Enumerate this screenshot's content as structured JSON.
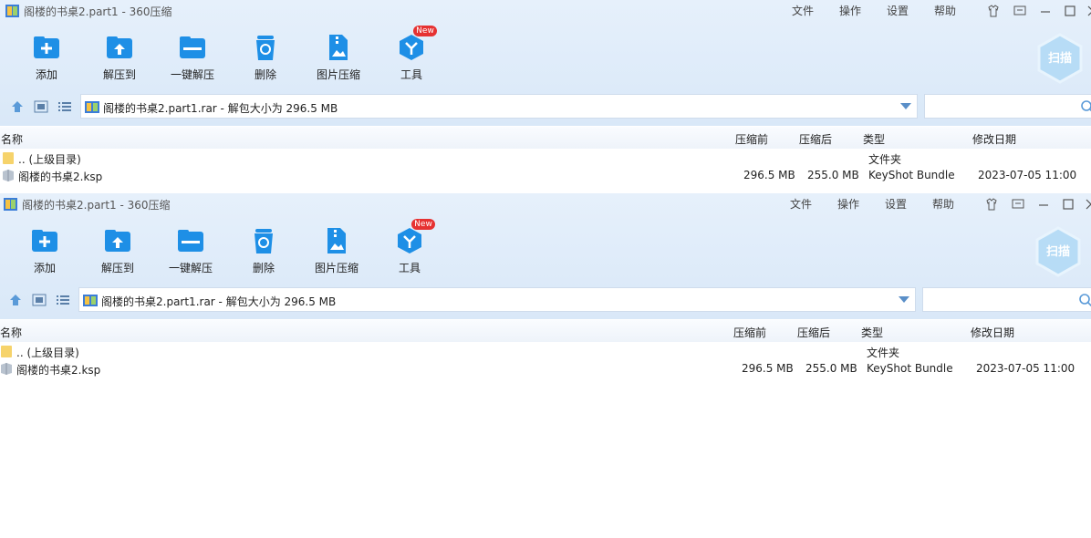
{
  "window": {
    "title": "阁楼的书桌2.part1 - 360压缩",
    "menu": [
      "文件",
      "操作",
      "设置",
      "帮助"
    ]
  },
  "toolbar": {
    "buttons": [
      "添加",
      "解压到",
      "一键解压",
      "删除",
      "图片压缩",
      "工具"
    ],
    "new_badge": "New",
    "scan_label": "扫描"
  },
  "path": {
    "text": "阁楼的书桌2.part1.rar - 解包大小为 296.5 MB"
  },
  "columns": {
    "name": "名称",
    "compressed_before": "压缩前",
    "compressed_after": "压缩后",
    "type": "类型",
    "modified": "修改日期"
  },
  "rows": [
    {
      "name": ".. (上级目录)",
      "before": "",
      "after": "",
      "type": "文件夹",
      "modified": ""
    },
    {
      "name": "阁楼的书桌2.ksp",
      "before": "296.5 MB",
      "after": "255.0 MB",
      "type": "KeyShot Bundle",
      "modified": "2023-07-05 11:00"
    }
  ],
  "colors": {
    "accent": "#1e8fe6",
    "header_bg": "#e1edf9"
  },
  "icons": [
    "app-icon",
    "add-icon",
    "extract-to-icon",
    "one-key-extract-icon",
    "delete-icon",
    "image-compress-icon",
    "tools-icon",
    "scan-icon",
    "up-icon",
    "view-icon",
    "list-icon",
    "archive-icon",
    "search-icon",
    "folder-icon",
    "file-icon"
  ]
}
